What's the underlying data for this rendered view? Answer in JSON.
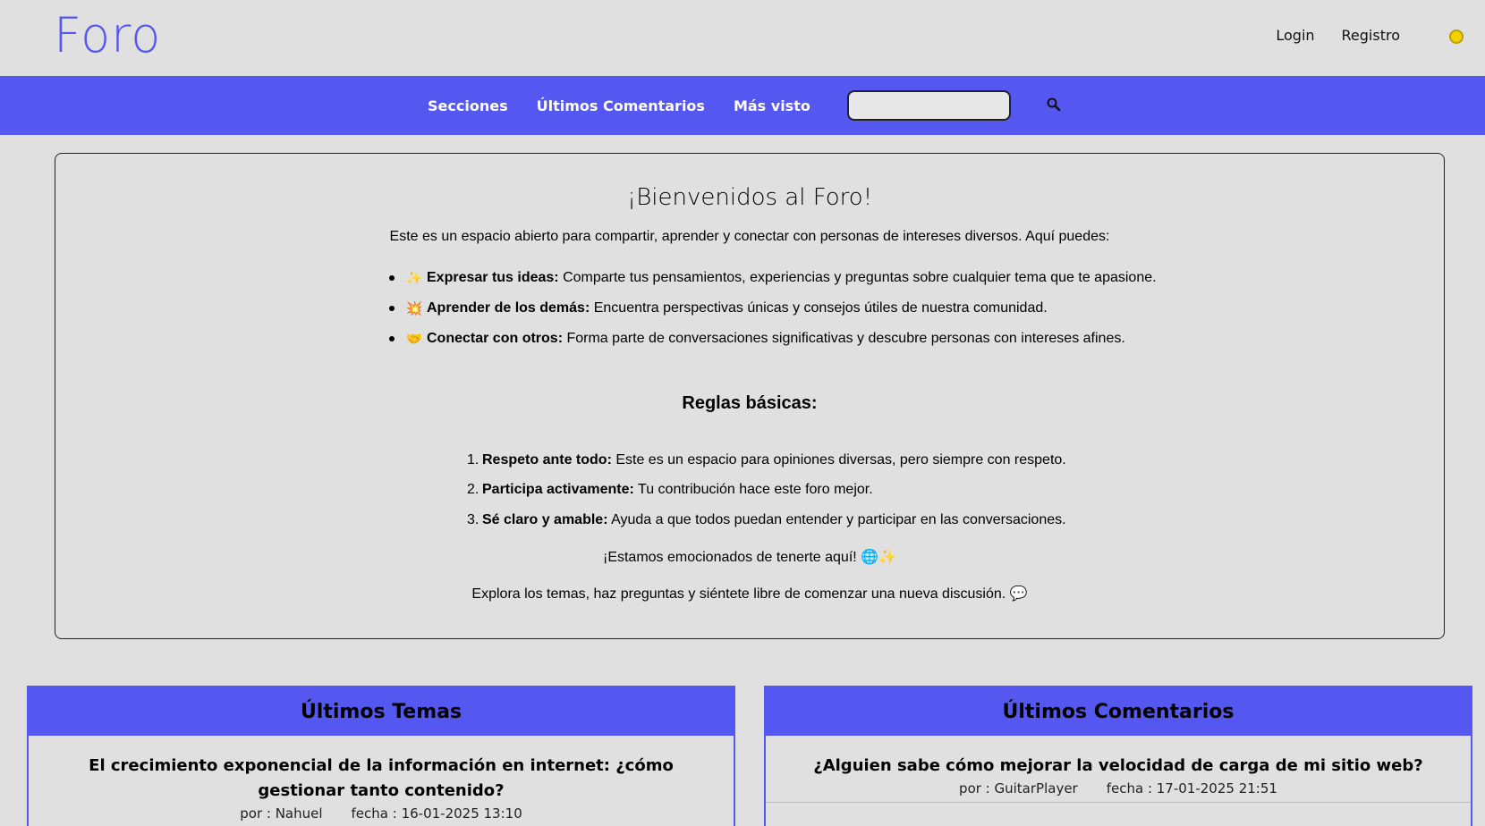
{
  "header": {
    "logo": "Foro",
    "login_label": "Login",
    "register_label": "Registro",
    "theme_toggle_color": "#f4d000"
  },
  "nav": {
    "items": [
      "Secciones",
      "Últimos Comentarios",
      "Más visto"
    ],
    "search_placeholder": "",
    "search_icon": "search-icon",
    "background": "#5558f0"
  },
  "welcome": {
    "title": "¡Bienvenidos al Foro!",
    "intro": "Este es un espacio abierto para compartir, aprender y conectar con personas de intereses diversos. Aquí puedes:",
    "items": [
      {
        "emoji": "✨",
        "bold": "Expresar tus ideas:",
        "text": " Comparte tus pensamientos, experiencias y preguntas sobre cualquier tema que te apasione."
      },
      {
        "emoji": "💥",
        "bold": "Aprender de los demás:",
        "text": " Encuentra perspectivas únicas y consejos útiles de nuestra comunidad."
      },
      {
        "emoji": "🤝",
        "bold": "Conectar con otros:",
        "text": " Forma parte de conversaciones significativas y descubre personas con intereses afines."
      }
    ],
    "rules_title": "Reglas básicas:",
    "rules": [
      {
        "num": "1.",
        "bold": "Respeto ante todo:",
        "text": " Este es un espacio para opiniones diversas, pero siempre con respeto."
      },
      {
        "num": "2.",
        "bold": "Participa activamente:",
        "text": " Tu contribución hace este foro mejor."
      },
      {
        "num": "3.",
        "bold": "Sé claro y amable:",
        "text": " Ayuda a que todos puedan entender y participar en las conversaciones."
      }
    ],
    "excited": "¡Estamos emocionados de tenerte aquí! 🌐✨",
    "explore": "Explora los temas, haz preguntas y siéntete libre de comenzar una nueva discusión. 💬"
  },
  "latest_topics": {
    "title": "Últimos Temas",
    "entries": [
      {
        "title": "El crecimiento exponencial de la información en internet: ¿cómo gestionar tanto contenido?",
        "author": "por : Nahuel",
        "date": "fecha : 16-01-2025 13:10"
      }
    ]
  },
  "latest_comments": {
    "title": "Últimos Comentarios",
    "entries": [
      {
        "title": "¿Alguien sabe cómo mejorar la velocidad de carga de mi sitio web?",
        "author": "por : GuitarPlayer",
        "date": "fecha : 17-01-2025 21:51"
      }
    ]
  }
}
